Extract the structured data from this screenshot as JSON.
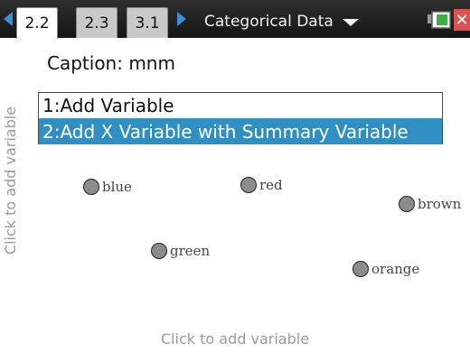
{
  "tabs": [
    {
      "label": "2.2",
      "active": true
    },
    {
      "label": "2.3",
      "active": false
    },
    {
      "label": "3.1",
      "active": false
    }
  ],
  "document": {
    "title": "Categorical Data"
  },
  "plot": {
    "caption": "Caption: mnm",
    "y_axis_hint": "Click to add variable",
    "x_axis_hint": "Click to add variable",
    "points": [
      {
        "label": "blue"
      },
      {
        "label": "red"
      },
      {
        "label": "brown"
      },
      {
        "label": "green"
      },
      {
        "label": "orange"
      }
    ]
  },
  "menu": {
    "items": [
      {
        "label": "1:Add Variable",
        "selected": false
      },
      {
        "label": "2:Add X Variable with Summary Variable",
        "selected": true
      }
    ]
  },
  "colors": {
    "titlebar": "#1f1f1f",
    "tab_nav_arrow": "#3a8fd6",
    "menu_selection": "#2f8fc2",
    "point_fill": "#8c8c8c",
    "close_button": "#d9534f",
    "battery": "#3cb043"
  },
  "icons": {
    "tab_prev": "left-arrow-icon",
    "tab_next": "right-arrow-icon",
    "title_dropdown": "chevron-down-icon",
    "battery": "battery-icon",
    "close": "close-icon"
  }
}
